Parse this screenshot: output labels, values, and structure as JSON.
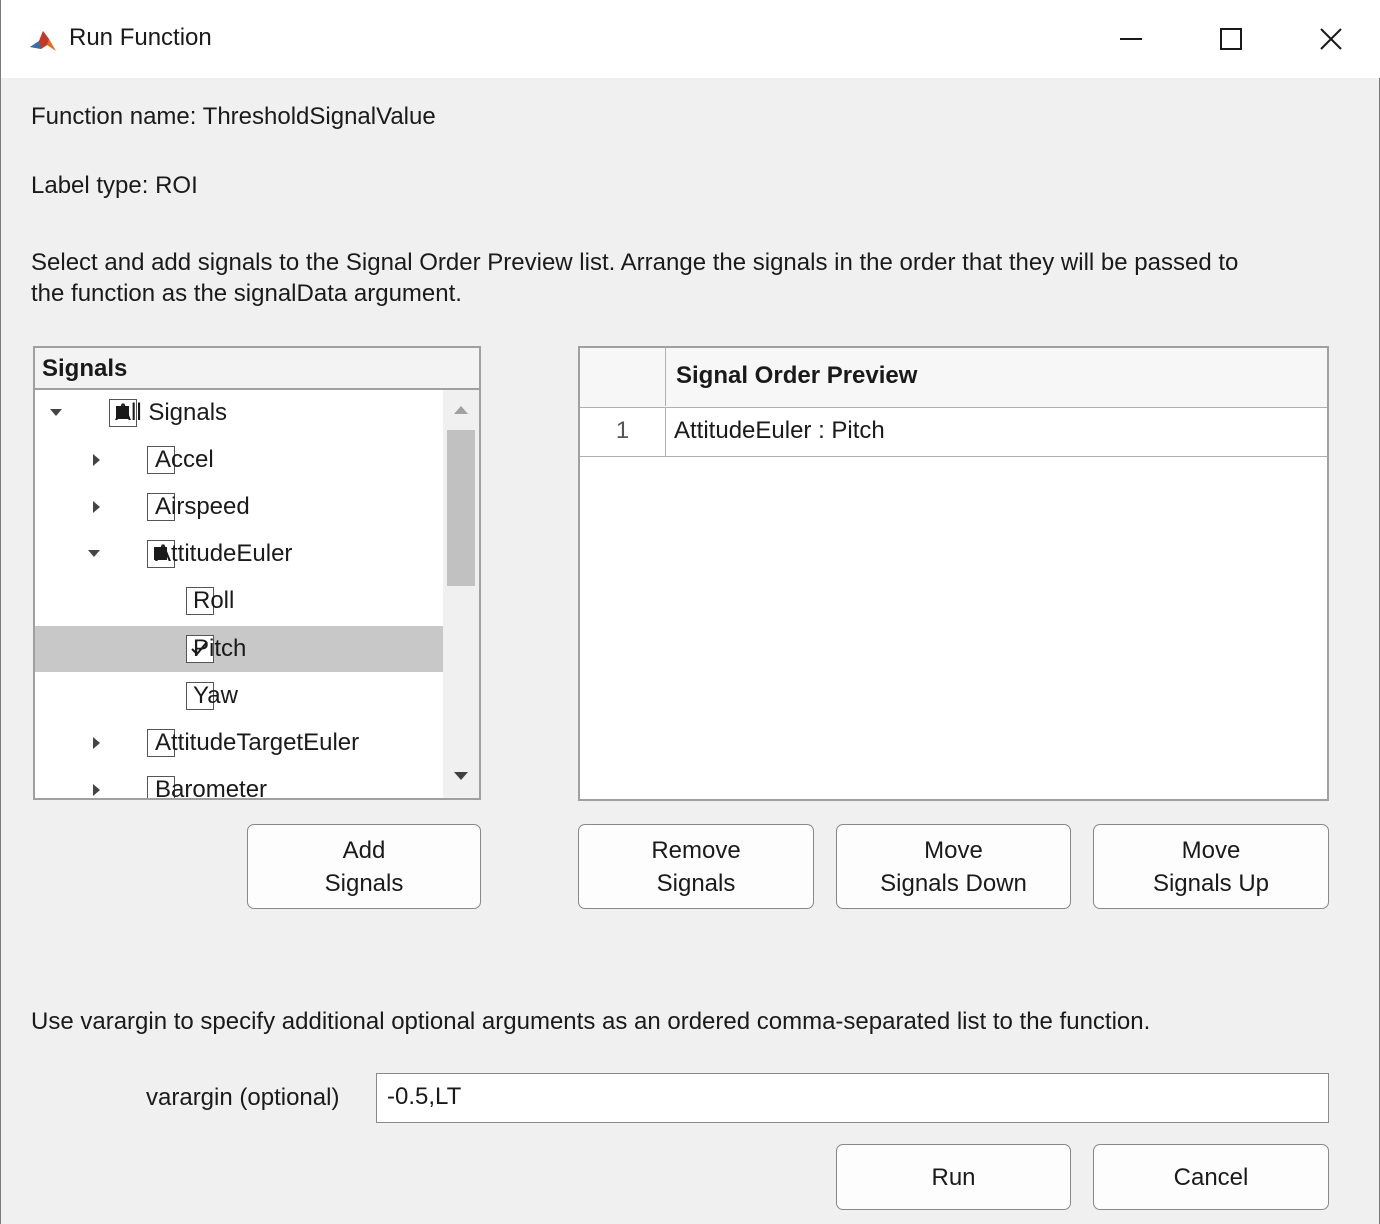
{
  "window": {
    "title": "Run Function",
    "controls": {
      "minimize_icon": "minimize-icon",
      "maximize_icon": "maximize-icon",
      "close_icon": "close-icon"
    }
  },
  "info": {
    "function_name": "Function name: ThresholdSignalValue",
    "label_type": "Label type: ROI",
    "instructions_line1": "Select and add signals to the Signal Order Preview list. Arrange the signals in the order that they will be passed to",
    "instructions_line2": "the function as the signalData argument."
  },
  "signals": {
    "header": "Signals",
    "items": [
      {
        "label": "All Signals",
        "expanded": true,
        "state": "mixed",
        "selected": false
      },
      {
        "label": "Accel",
        "expanded": false,
        "state": "unchecked",
        "selected": false
      },
      {
        "label": "Airspeed",
        "expanded": false,
        "state": "unchecked",
        "selected": false
      },
      {
        "label": "AttitudeEuler",
        "expanded": true,
        "state": "mixed",
        "selected": false
      },
      {
        "label": "Roll",
        "state": "unchecked",
        "selected": false
      },
      {
        "label": "Pitch",
        "state": "checked",
        "selected": true
      },
      {
        "label": "Yaw",
        "state": "unchecked",
        "selected": false
      },
      {
        "label": "AttitudeTargetEuler",
        "expanded": false,
        "state": "unchecked",
        "selected": false
      },
      {
        "label": "Barometer",
        "expanded": false,
        "state": "unchecked",
        "selected": false
      }
    ]
  },
  "order_preview": {
    "header": "Signal Order Preview",
    "rows": [
      {
        "index": "1",
        "value": "AttitudeEuler : Pitch"
      }
    ]
  },
  "buttons": {
    "add_signals": "Add\nSignals",
    "remove_signals": "Remove\nSignals",
    "move_down": "Move\nSignals Down",
    "move_up": "Move\nSignals Up",
    "run": "Run",
    "cancel": "Cancel"
  },
  "varargin": {
    "description": "Use varargin to specify additional optional arguments as an ordered comma-separated list to the function.",
    "label": "varargin (optional)",
    "value": "-0.5,LT"
  },
  "colors": {
    "background": "#f0f0f0",
    "selected_row": "#c8c8c8",
    "border": "#a0a0a0"
  }
}
